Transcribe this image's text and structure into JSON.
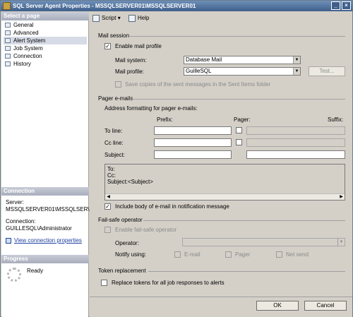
{
  "window": {
    "title": "SQL Server Agent Properties - MSSQLSERVER01\\MSSQLSERVER01"
  },
  "sidebar": {
    "select_page_header": "Select a page",
    "items": [
      {
        "label": "General",
        "selected": false
      },
      {
        "label": "Advanced",
        "selected": false
      },
      {
        "label": "Alert System",
        "selected": true
      },
      {
        "label": "Job System",
        "selected": false
      },
      {
        "label": "Connection",
        "selected": false
      },
      {
        "label": "History",
        "selected": false
      }
    ],
    "connection_header": "Connection",
    "server_label": "Server:",
    "server_value": "MSSQLSERVER01\\MSSQLSER\\",
    "connection_label": "Connection:",
    "connection_value": "GUILLESQL\\Administrator",
    "view_connection_link": "View connection properties",
    "progress_header": "Progress",
    "progress_status": "Ready"
  },
  "toolbar": {
    "script_label": "Script",
    "help_label": "Help"
  },
  "mail_session": {
    "header": "Mail session",
    "enable_label": "Enable mail profile",
    "enable_checked": true,
    "mail_system_label": "Mail system:",
    "mail_system_value": "Database Mail",
    "mail_profile_label": "Mail profile:",
    "mail_profile_value": "GuilleSQL",
    "test_button": "Test...",
    "save_copies_label": "Save copies of the sent messages in the Sent Items folder"
  },
  "pager": {
    "header": "Pager e-mails",
    "address_label": "Address formatting for pager e-mails:",
    "col_prefix": "Prefix:",
    "col_pager": "Pager:",
    "col_suffix": "Suffix:",
    "to_label": "To line:",
    "cc_label": "Cc line:",
    "subject_label": "Subject:",
    "preview_to": "To:",
    "preview_cc": "Cc:",
    "preview_subject": "Subject:<Subject>",
    "include_body_label": "Include body of e-mail in notification message",
    "include_body_checked": true
  },
  "failsafe": {
    "header": "Fail-safe operator",
    "enable_label": "Enable fail-safe operator",
    "operator_label": "Operator:",
    "notify_label": "Notify using:",
    "email_label": "E-mail",
    "pager_label": "Pager",
    "netsend_label": "Net send"
  },
  "token": {
    "header": "Token replacement",
    "replace_label": "Replace tokens for all job responses to alerts"
  },
  "footer": {
    "ok_button": "OK",
    "cancel_button": "Cancel"
  }
}
